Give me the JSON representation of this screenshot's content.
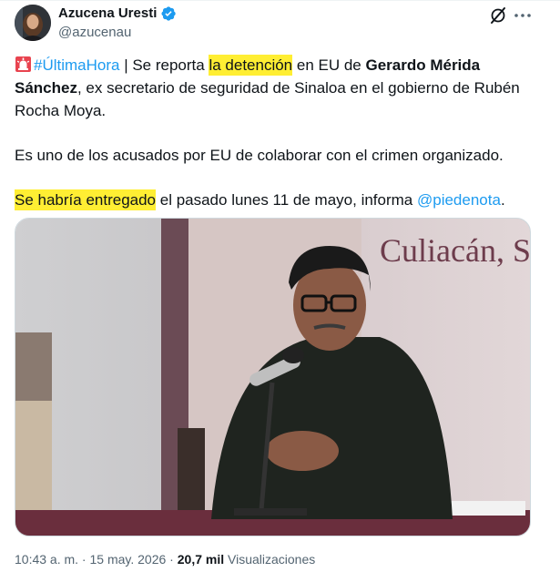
{
  "author": {
    "display_name": "Azucena Uresti",
    "handle": "@azucenau",
    "verified": true
  },
  "icons": {
    "verified": "verified-badge-icon",
    "grok": "grok-icon",
    "more": "more-icon",
    "siren": "siren-emoji-icon"
  },
  "tweet": {
    "hashtag": "#ÚltimaHora",
    "segments": {
      "s1": " | Se reporta ",
      "hl1": "la detención",
      "s2": " en EU de ",
      "bold_name": "Gerardo Mérida Sánchez",
      "s3": ", ex secretario de seguridad de Sinaloa en el gobierno de Rubén Rocha Moya.",
      "p2": "Es uno de los acusados por EU de colaborar con el crimen organizado.",
      "hl2": "Se habría entregado",
      "s4": " el pasado lunes 11 de mayo, informa ",
      "mention": "@piedenota",
      "s5": "."
    },
    "image_wall_text": "Culiacán, S"
  },
  "meta": {
    "time": "10:43 a. m.",
    "separator": " · ",
    "date": "15 may. 2026",
    "views_count": "20,7 mil",
    "views_label": " Visualizaciones"
  },
  "colors": {
    "text": "#0f1419",
    "secondary": "#536471",
    "link": "#1d9bf0",
    "highlight": "#ffee33",
    "verified": "#1d9bf0"
  }
}
